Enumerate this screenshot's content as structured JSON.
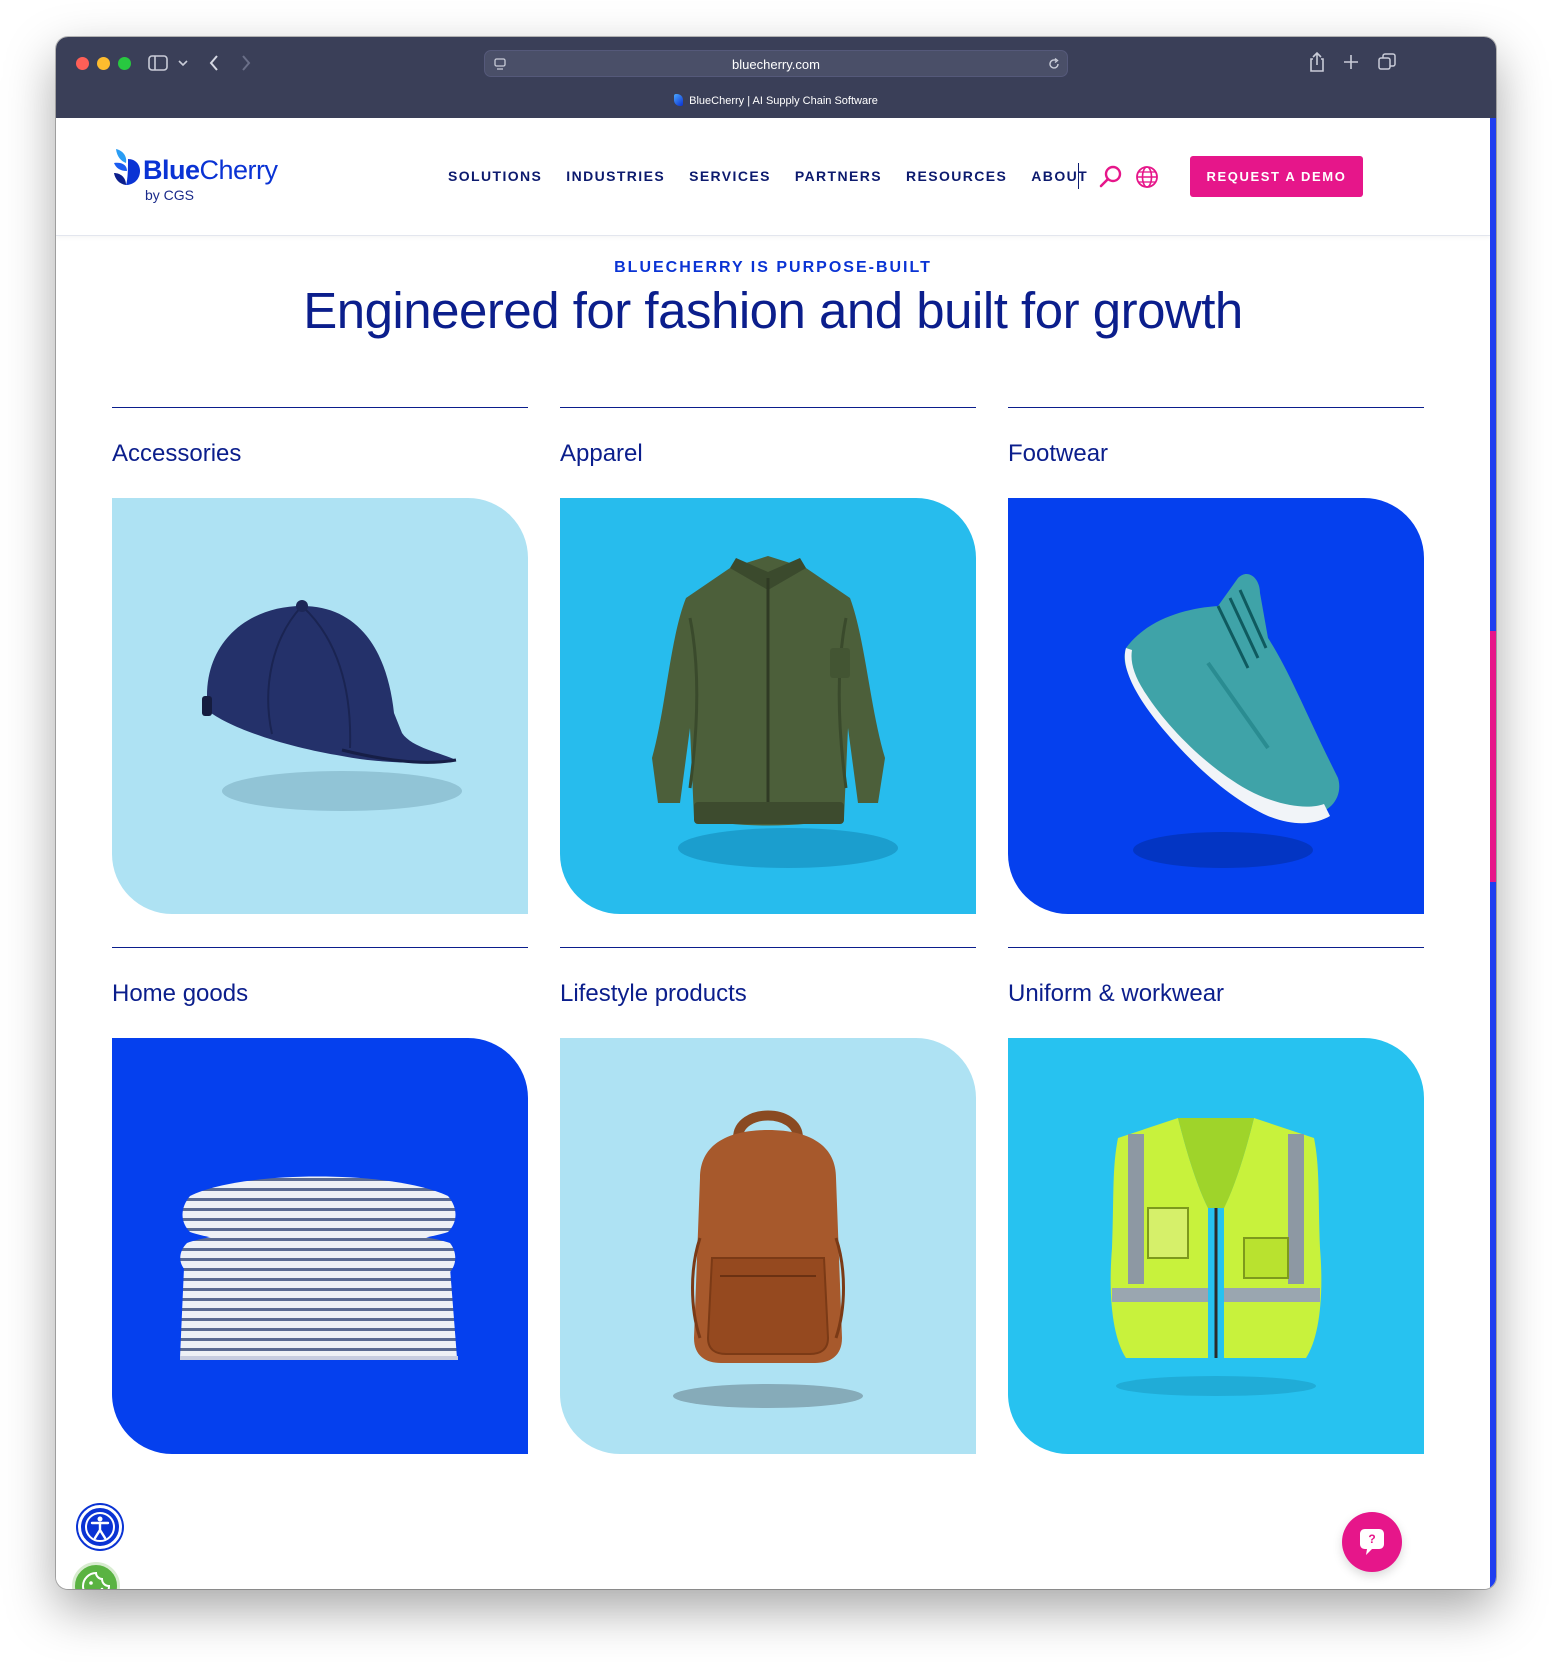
{
  "browser": {
    "url": "bluecherry.com",
    "tab_title": "BlueCherry | AI Supply Chain Software",
    "icons": [
      "sidebar-icon",
      "chevron-down-icon",
      "back-icon",
      "forward-icon",
      "site-settings-icon",
      "reload-icon",
      "share-icon",
      "new-tab-icon",
      "tabs-overview-icon"
    ]
  },
  "brand": {
    "name_bold": "Blue",
    "name_rest": "Cherry",
    "byline": "by CGS",
    "accent": "#0a33d4",
    "navy": "#0b1e8c",
    "pink": "#e6168a"
  },
  "nav": {
    "items": [
      "SOLUTIONS",
      "INDUSTRIES",
      "SERVICES",
      "PARTNERS",
      "RESOURCES",
      "ABOUT"
    ],
    "cta": "REQUEST A DEMO",
    "icons": [
      "search-icon",
      "globe-icon"
    ]
  },
  "hero": {
    "eyebrow": "BLUECHERRY IS PURPOSE-BUILT",
    "headline": "Engineered for fashion and built for growth"
  },
  "categories": [
    {
      "title": "Accessories",
      "bg": "#aee2f3",
      "image": "cap"
    },
    {
      "title": "Apparel",
      "bg": "#27bced",
      "image": "jacket"
    },
    {
      "title": "Footwear",
      "bg": "#0540ee",
      "image": "sneaker"
    },
    {
      "title": "Home goods",
      "bg": "#0540ee",
      "image": "pillows"
    },
    {
      "title": "Lifestyle products",
      "bg": "#aee2f3",
      "image": "backpack"
    },
    {
      "title": "Uniform & workwear",
      "bg": "#27c2f0",
      "image": "vest"
    }
  ],
  "floating": {
    "accessibility_icon": "accessibility-icon",
    "cookie_icon": "cookie-icon",
    "chat_label": "?"
  }
}
